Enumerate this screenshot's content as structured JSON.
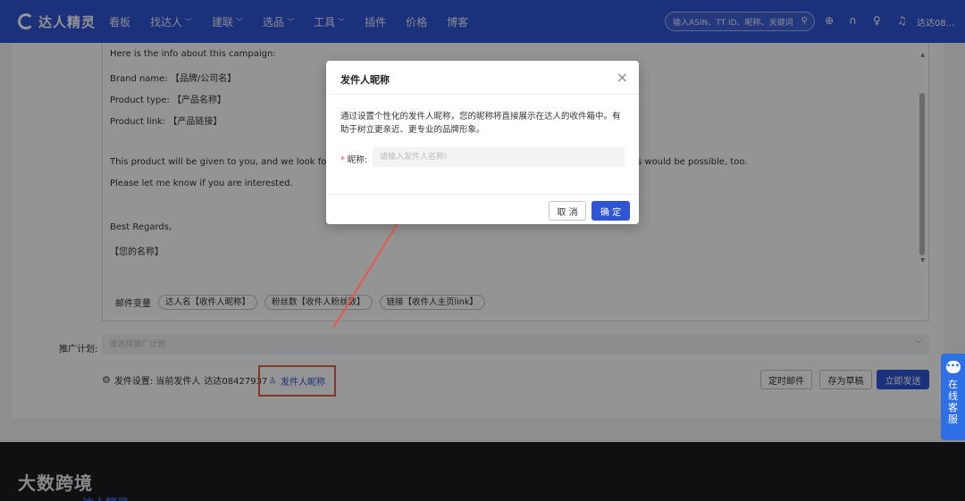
{
  "nav": {
    "logo": "达人精灵",
    "items": [
      {
        "label": "看板",
        "dropdown": false
      },
      {
        "label": "找达人",
        "dropdown": true
      },
      {
        "label": "建联",
        "dropdown": true
      },
      {
        "label": "选品",
        "dropdown": true
      },
      {
        "label": "工具",
        "dropdown": true
      },
      {
        "label": "插件",
        "dropdown": false
      },
      {
        "label": "价格",
        "dropdown": false
      },
      {
        "label": "博客",
        "dropdown": false
      }
    ],
    "search_placeholder": "输入ASIN、TT ID、昵称、关键词",
    "icons": [
      "globe-icon",
      "headset-icon",
      "bulb-icon",
      "bell-icon"
    ],
    "user": "达达08..."
  },
  "email": {
    "lines": [
      "Here is the info about this campaign:",
      "Brand name: 【品牌/公司名】",
      "Product type: 【产品名称】",
      "Product link: 【产品链接】",
      "This product will be given to you, and we look forward t",
      "s would be possible, too.",
      "Please let me know if you are interested.",
      "Best Regards,",
      "【您的名称】"
    ],
    "variables_label": "邮件变量",
    "variables": [
      "达人名【收件人昵称】",
      "粉丝数【收件人粉丝数】",
      "链接【收件人主页link】"
    ]
  },
  "plan": {
    "label": "推广计划:",
    "placeholder": "请选择推广计划"
  },
  "sender": {
    "label": "发件设置: 当前发件人",
    "current": "达达08427937",
    "nickname_button": "发件人昵称"
  },
  "actions": {
    "schedule": "定时邮件",
    "draft": "存为草稿",
    "send": "立即发送"
  },
  "dialog": {
    "title": "发件人昵称",
    "description": "通过设置个性化的发件人昵称，您的昵称将直接展示在达人的收件箱中。有助于树立更亲近、更专业的品牌形象。",
    "field_label": "昵称:",
    "field_placeholder": "请输入发件人名称!",
    "field_value": "",
    "cancel": "取 消",
    "confirm": "确 定"
  },
  "chat": {
    "label": "在线客服"
  },
  "footer": {
    "brand": "大数跨境",
    "sub": "达人精灵"
  },
  "colors": {
    "brand": "#2f55d4",
    "highlight": "#e8584f",
    "chat": "#2f6fe6"
  }
}
